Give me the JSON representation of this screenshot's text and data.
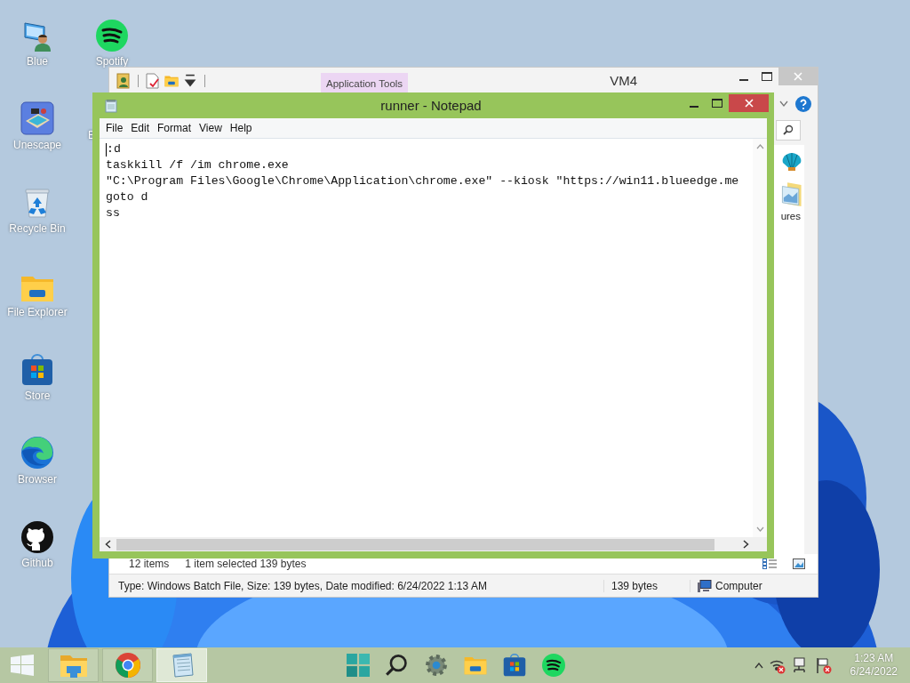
{
  "desktop_icons": [
    {
      "label": "Blue",
      "kind": "user-monitor"
    },
    {
      "label": "Unescape",
      "kind": "game"
    },
    {
      "label": "Recycle Bin",
      "kind": "recycle-bin"
    },
    {
      "label": "File Explorer",
      "kind": "folder"
    },
    {
      "label": "Store",
      "kind": "store"
    },
    {
      "label": "Browser",
      "kind": "swirl"
    },
    {
      "label": "Github",
      "kind": "cat"
    },
    {
      "label": "Spotify",
      "kind": "music"
    }
  ],
  "hidden_desktop_label": "E",
  "explorer": {
    "title": "VM4",
    "context_tab": "Application Tools",
    "quick_access": [
      {
        "kind": "properties"
      },
      {
        "kind": "document"
      },
      {
        "kind": "folder"
      },
      {
        "kind": "dropdown"
      }
    ],
    "visible_item": {
      "label": "ures",
      "kind": "picture"
    },
    "item_count": "12 items",
    "selection": "1 item selected  139 bytes",
    "status_bar": {
      "details": "Type: Windows Batch File, Size: 139 bytes, Date modified: 6/24/2022 1:13 AM",
      "size": "139 bytes",
      "location": "Computer"
    }
  },
  "notepad": {
    "title": "runner - Notepad",
    "menu": [
      "File",
      "Edit",
      "Format",
      "View",
      "Help"
    ],
    "lines": [
      ":d",
      "taskkill /f /im chrome.exe",
      "\"C:\\Program Files\\Google\\Chrome\\Application\\chrome.exe\" --kiosk \"https://win11.blueedge.me",
      "goto d",
      "ss"
    ]
  },
  "taskbar": {
    "running": [
      {
        "kind": "start",
        "active": false
      },
      {
        "kind": "explorer",
        "active": false
      },
      {
        "kind": "chrome",
        "active": false
      },
      {
        "kind": "notepad",
        "active": true
      }
    ],
    "pinned": [
      {
        "kind": "tiles"
      },
      {
        "kind": "search"
      },
      {
        "kind": "gear"
      },
      {
        "kind": "folder"
      },
      {
        "kind": "store"
      },
      {
        "kind": "music"
      }
    ],
    "tray": [
      {
        "kind": "chevron"
      },
      {
        "kind": "wifi-x"
      },
      {
        "kind": "network"
      },
      {
        "kind": "flag-x"
      }
    ],
    "time": "1:23 AM",
    "date": "6/24/2022"
  }
}
